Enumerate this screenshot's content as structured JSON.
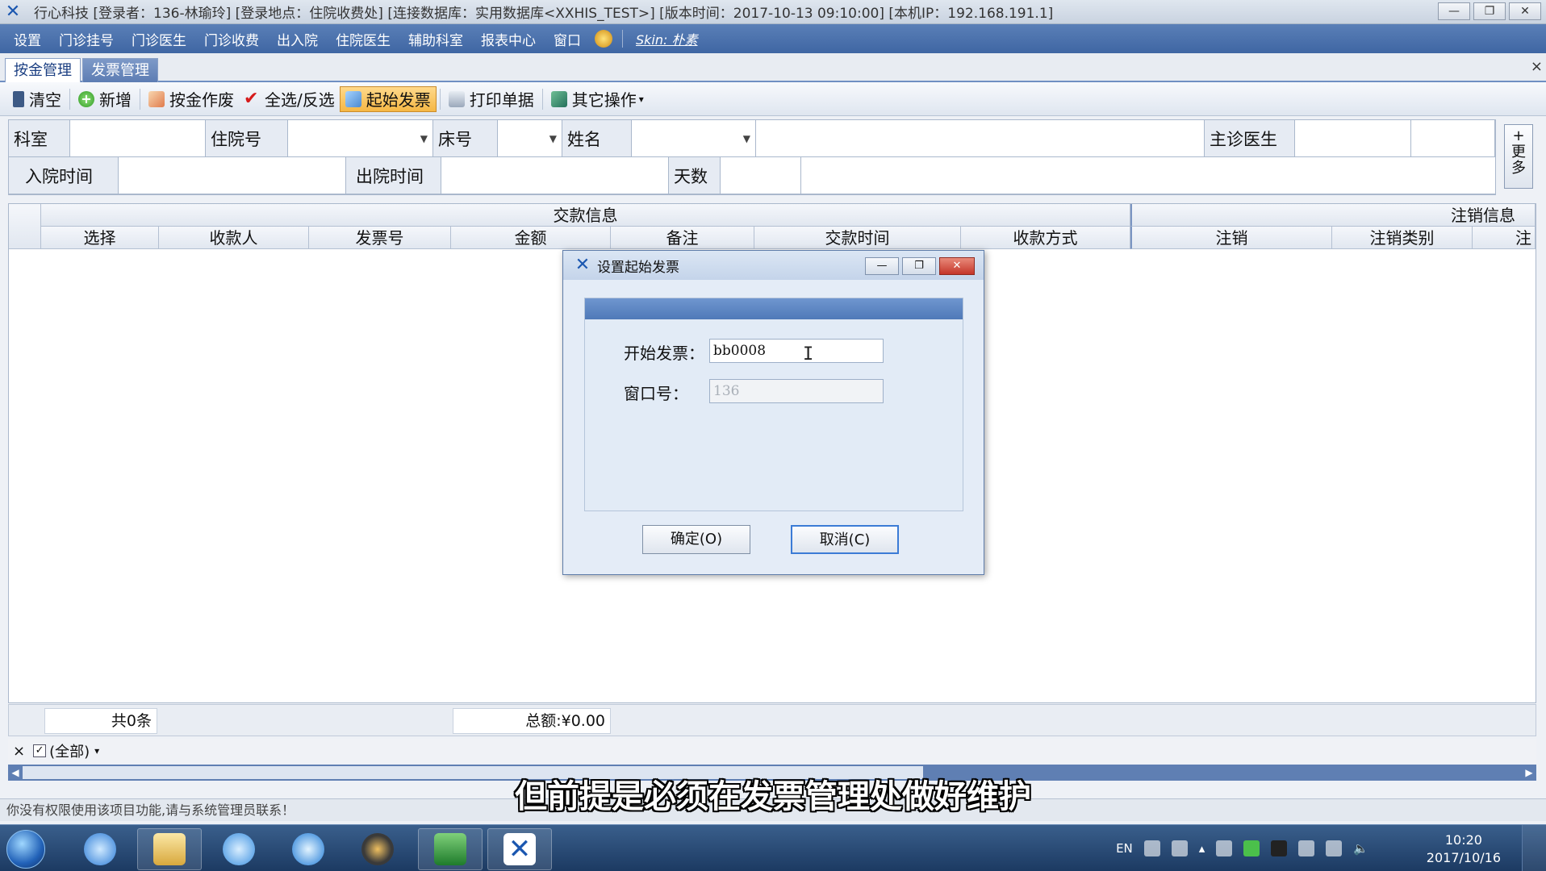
{
  "app": {
    "title": "行心科技    [登录者：136-林瑜玲] [登录地点：住院收费处] [连接数据库：实用数据库<XXHIS_TEST>] [版本时间：2017-10-13 09:10:00]         [本机IP：192.168.191.1]"
  },
  "window_controls": {
    "minimize": "—",
    "restore": "❐",
    "close": "✕"
  },
  "menu": {
    "items": [
      "设置",
      "门诊挂号",
      "门诊医生",
      "门诊收费",
      "出入院",
      "住院医生",
      "辅助科室",
      "报表中心",
      "窗口"
    ],
    "skin": "Skin: 朴素"
  },
  "tabs": [
    {
      "label": "按金管理",
      "active": true
    },
    {
      "label": "发票管理",
      "active": false
    }
  ],
  "toolbar": {
    "clear": "清空",
    "add": "新增",
    "void_deposit": "按金作废",
    "select_all": "全选/反选",
    "start_invoice": "起始发票",
    "print": "打印单据",
    "other": "其它操作"
  },
  "filter": {
    "dept_label": "科室",
    "inpatient_no_label": "住院号",
    "bed_label": "床号",
    "name_label": "姓名",
    "doctor_label": "主诊医生",
    "admit_label": "入院时间",
    "discharge_label": "出院时间",
    "days_label": "天数",
    "more": "+ 更 多"
  },
  "grid": {
    "group1": "交款信息",
    "group2": "注销信息",
    "columns": [
      "选择",
      "收款人",
      "发票号",
      "金额",
      "备注",
      "交款时间",
      "收款方式",
      "注销",
      "注销类别",
      "注"
    ],
    "count": "共0条",
    "total": "总额:¥0.00",
    "filter_all": "(全部)"
  },
  "status": {
    "message": "你没有权限使用该项目功能,请与系统管理员联系！"
  },
  "subtitle": "但前提是必须在发票管理处做好维护",
  "dialog": {
    "title": "设置起始发票",
    "start_label": "开始发票：",
    "start_value": "bb0008",
    "window_label": "窗口号：",
    "window_value": "136",
    "ok": "确定(O)",
    "cancel": "取消(C)"
  },
  "taskbar": {
    "lang": "EN",
    "time": "10:20",
    "date": "2017/10/16"
  }
}
